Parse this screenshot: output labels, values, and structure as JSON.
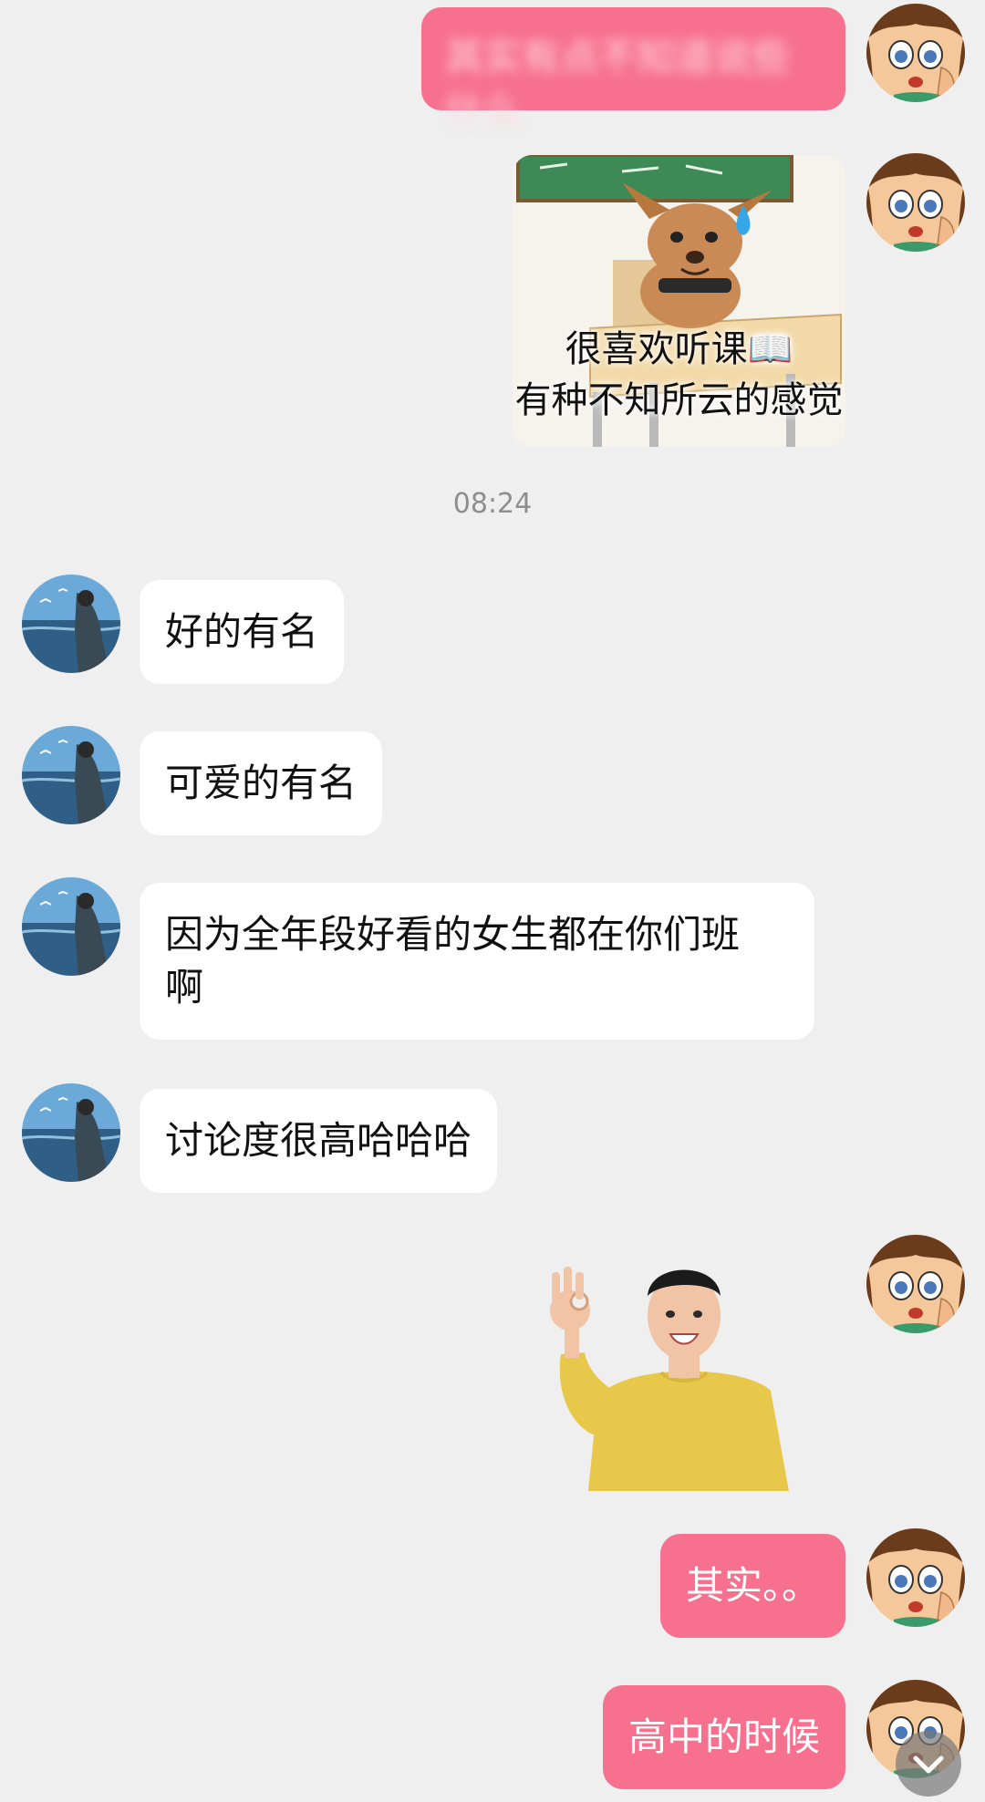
{
  "messages": {
    "m1_text": "其实有点不知道说些什么",
    "m2_caption_line1": "很喜欢听课📖",
    "m2_caption_line2": "有种不知所云的感觉",
    "timestamp": "08:24",
    "m3_text": "好的有名",
    "m4_text": "可爱的有名",
    "m5_text_line1": "因为全年段好看的女生都在你们班",
    "m5_text_line2": "啊",
    "m6_text": "讨论度很高哈哈哈",
    "m8_text": "其实。。",
    "m9_text": "高中的时候"
  },
  "colors": {
    "background": "#efefef",
    "self_bubble": "#f7718f",
    "other_bubble": "#ffffff"
  },
  "icons": {
    "scroll_down": "chevron-down-icon"
  }
}
